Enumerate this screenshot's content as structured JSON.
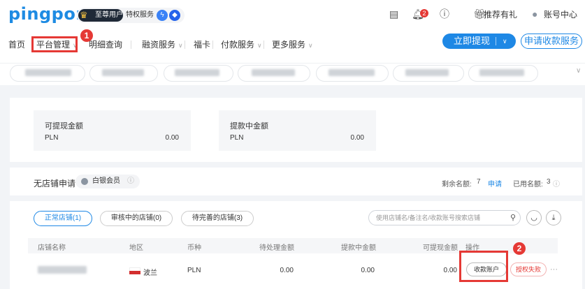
{
  "header": {
    "logo": "pingpong",
    "vip_label": "至尊用户",
    "special_service": "特权服务",
    "notification_count": "2",
    "recommend_label": "推荐有礼",
    "account_center": "账号中心"
  },
  "nav": {
    "items": [
      "首页",
      "平台管理",
      "明细查询",
      "融资服务",
      "福卡",
      "付款服务",
      "更多服务"
    ],
    "withdraw_label": "立即提现",
    "apply_label": "申请收款服务"
  },
  "balances": [
    {
      "title": "可提现金额",
      "currency": "PLN",
      "amount": "0.00"
    },
    {
      "title": "提款中金额",
      "currency": "PLN",
      "amount": "0.00"
    }
  ],
  "store": {
    "title": "无店铺申请",
    "member_level": "白银会员",
    "quota_remaining_label": "剩余名额:",
    "quota_remaining_value": "7",
    "apply_link": "申请",
    "quota_used_label": "已用名额:",
    "quota_used_value": "3"
  },
  "tabs": [
    "正常店铺(1)",
    "审核中的店铺(0)",
    "待完善的店铺(3)"
  ],
  "search": {
    "placeholder": "使用店铺名/备注名/收款账号搜索店铺"
  },
  "table": {
    "headers": [
      "店铺名称",
      "地区",
      "币种",
      "待处理金额",
      "提款中金额",
      "可提现金额",
      "操作"
    ],
    "rows": [
      {
        "region": "波兰",
        "currency": "PLN",
        "pending": "0.00",
        "withdrawing": "0.00",
        "available": "0.00",
        "action1": "收款账户",
        "action2": "授权失败",
        "more": "···"
      }
    ]
  },
  "annotations": [
    "1",
    "2"
  ],
  "colors": {
    "accent": "#1e88e5",
    "highlight": "#e53935"
  }
}
